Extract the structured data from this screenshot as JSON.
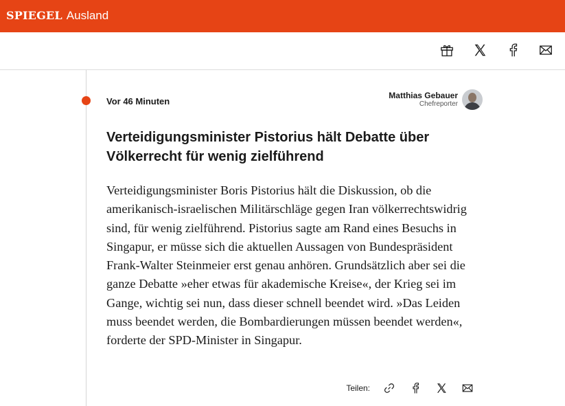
{
  "header": {
    "brand": "SPIEGEL",
    "section": "Ausland",
    "brand_color": "#e64415"
  },
  "top_share": {
    "icons": [
      "gift-icon",
      "x-icon",
      "facebook-icon",
      "mail-icon"
    ]
  },
  "entry": {
    "time": "Vor 46 Minuten",
    "author": {
      "name": "Matthias Gebauer",
      "role": "Chefreporter"
    },
    "headline": "Verteidigungsminister Pistorius hält Debatte über Völkerrecht für wenig zielführend",
    "body": "Verteidigungsminister Boris Pistorius hält die Diskussion, ob die amerikanisch-israelischen Militärschläge gegen Iran völkerrechtswidrig sind, für wenig zielführend. Pistorius sagte am Rand eines Besuchs in Singapur, er müsse sich die aktuellen Aussagen von Bundespräsident Frank-Walter Steinmeier erst genau anhören. Grundsätzlich aber sei die ganze Debatte »eher etwas für akademische Kreise«, der Krieg sei im Gange, wichtig sei nun, dass dieser schnell beendet wird. »Das Leiden muss beendet werden, die Bombardierungen müssen beendet werden«, forderte der SPD-Minister in Singapur.",
    "share_label": "Teilen:",
    "share_icons": [
      "link-icon",
      "facebook-icon",
      "x-icon",
      "mail-icon"
    ]
  }
}
